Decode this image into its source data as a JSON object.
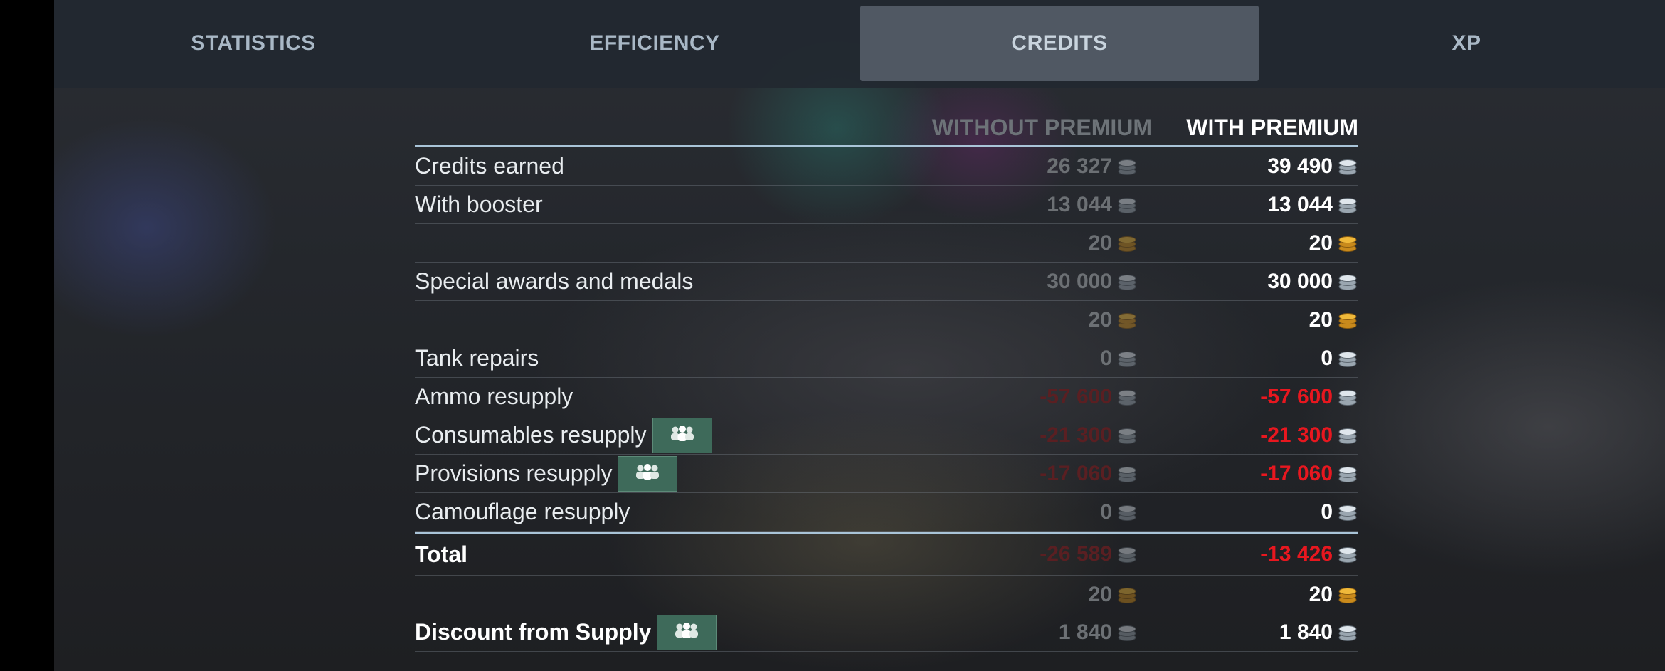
{
  "tabs": [
    {
      "label": "STATISTICS"
    },
    {
      "label": "EFFICIENCY"
    },
    {
      "label": "CREDITS"
    },
    {
      "label": "XP"
    }
  ],
  "active_tab": "CREDITS",
  "columns": {
    "without_premium": "WITHOUT PREMIUM",
    "with_premium": "WITH PREMIUM"
  },
  "rows": [
    {
      "label": "Credits earned",
      "without": "26 327",
      "with": "39 490",
      "currency": "silver"
    },
    {
      "label": "With booster",
      "without": "13 044",
      "with": "13 044",
      "currency": "silver"
    },
    {
      "label": "",
      "without": "20",
      "with": "20",
      "currency": "gold"
    },
    {
      "label": "Special awards and medals",
      "without": "30 000",
      "with": "30 000",
      "currency": "silver"
    },
    {
      "label": "",
      "without": "20",
      "with": "20",
      "currency": "gold"
    },
    {
      "label": "Tank repairs",
      "without": "0",
      "with": "0",
      "currency": "silver"
    },
    {
      "label": "Ammo resupply",
      "without": "-57 600",
      "with": "-57 600",
      "currency": "silver"
    },
    {
      "label": "Consumables resupply",
      "without": "-21 300",
      "with": "-21 300",
      "currency": "silver",
      "crew_button": true
    },
    {
      "label": "Provisions resupply",
      "without": "-17 060",
      "with": "-17 060",
      "currency": "silver",
      "crew_button": true
    },
    {
      "label": "Camouflage resupply",
      "without": "0",
      "with": "0",
      "currency": "silver"
    }
  ],
  "total": {
    "label": "Total",
    "without": "-26 589",
    "with": "-13 426",
    "currency": "silver",
    "gold_without": "20",
    "gold_with": "20"
  },
  "discount": {
    "label": "Discount from Supply",
    "without": "1 840",
    "with": "1 840",
    "currency": "silver",
    "crew_button": true
  },
  "colors": {
    "silver_coin": "#c9d2da",
    "gold_coin": "#e0a62a",
    "negative": "#e8171f",
    "header_rule": "#a9c4d8"
  },
  "icons": {
    "silver": "silver-coin-icon",
    "gold": "gold-coin-icon",
    "crew": "crew-group-icon"
  }
}
